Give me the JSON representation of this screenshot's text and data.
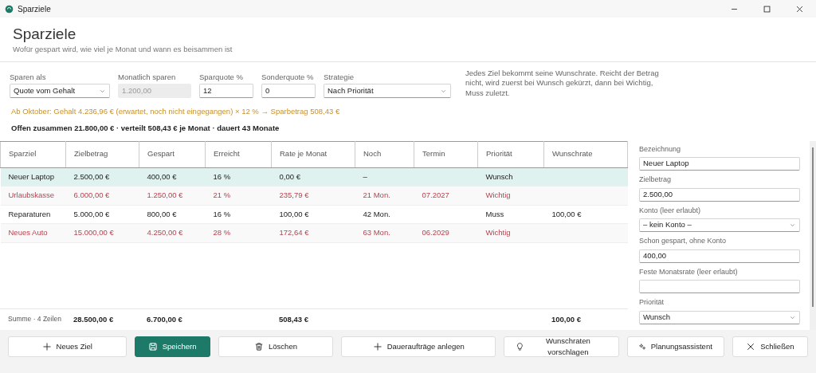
{
  "window": {
    "title": "Sparziele"
  },
  "header": {
    "title": "Sparziele",
    "subtitle": "Wofür gespart wird, wie viel je Monat und wann es beisammen ist"
  },
  "settings": [
    {
      "kind": "select",
      "label": "Sparen als",
      "value": "Quote vom Gehalt",
      "disabled": false
    },
    {
      "kind": "input",
      "label": "Monatlich sparen",
      "value": "1.200,00",
      "disabled": true
    },
    {
      "kind": "input",
      "label": "Sparquote %",
      "value": "12",
      "disabled": false
    },
    {
      "kind": "input",
      "label": "Sonderquote %",
      "value": "0",
      "disabled": false
    },
    {
      "kind": "select",
      "label": "Strategie",
      "value": "Nach Priorität",
      "disabled": false
    }
  ],
  "strategy_note": "Jedes Ziel bekommt seine Wunschrate. Reicht der Betrag nicht, wird zuerst bei Wunsch gekürzt, dann bei Wichtig, Muss zuletzt.",
  "forecast_note": "Ab Oktober: Gehalt 4.236,96 € (erwartet, noch nicht eingegangen) × 12 % → Sparbetrag 508,43 €",
  "summary": "Offen zusammen 21.800,00 € · verteilt 508,43 € je Monat · dauert 43 Monate",
  "table": {
    "columns": [
      "Sparziel",
      "Zielbetrag",
      "Gespart",
      "Erreicht",
      "Rate je Monat",
      "Noch",
      "Termin",
      "Priorität",
      "Wunschrate"
    ],
    "rows": [
      {
        "selected": true,
        "critical": false,
        "cells": [
          "Neuer Laptop",
          "2.500,00 €",
          "400,00 €",
          "16 %",
          "0,00 €",
          "–",
          "",
          "Wunsch",
          ""
        ]
      },
      {
        "selected": false,
        "critical": true,
        "cells": [
          "Urlaubskasse",
          "6.000,00 €",
          "1.250,00 €",
          "21 %",
          "235,79 €",
          "21 Mon.",
          "07.2027",
          "Wichtig",
          ""
        ]
      },
      {
        "selected": false,
        "critical": false,
        "cells": [
          "Reparaturen",
          "5.000,00 €",
          "800,00 €",
          "16 %",
          "100,00 €",
          "42 Mon.",
          "",
          "Muss",
          "100,00 €"
        ]
      },
      {
        "selected": false,
        "critical": true,
        "cells": [
          "Neues Auto",
          "15.000,00 €",
          "4.250,00 €",
          "28 %",
          "172,64 €",
          "63 Mon.",
          "06.2029",
          "Wichtig",
          ""
        ]
      }
    ],
    "totals": {
      "label": "Summe · 4 Zeilen",
      "zielbetrag": "28.500,00 €",
      "gespart": "6.700,00 €",
      "rate_je_monat": "508,43 €",
      "wunschrate": "100,00 €"
    }
  },
  "details": [
    {
      "kind": "input",
      "label": "Bezeichnung",
      "value": "Neuer Laptop"
    },
    {
      "kind": "input",
      "label": "Zielbetrag",
      "value": "2.500,00"
    },
    {
      "kind": "select",
      "label": "Konto (leer erlaubt)",
      "value": "– kein Konto –"
    },
    {
      "kind": "input",
      "label": "Schon gespart, ohne Konto",
      "value": "400,00"
    },
    {
      "kind": "input",
      "label": "Feste Monatsrate (leer erlaubt)"
    },
    {
      "kind": "select",
      "label": "Priorität",
      "value": "Wunsch"
    }
  ],
  "buttons": [
    {
      "label": "Neues Ziel",
      "primary": false
    },
    {
      "label": "Speichern",
      "primary": true
    },
    {
      "label": "Löschen",
      "primary": false
    },
    {
      "label": "Daueraufträge anlegen",
      "primary": false
    },
    {
      "label": "Wunschraten vorschlagen",
      "primary": false
    },
    {
      "label": "Planungsassistent",
      "primary": false
    },
    {
      "label": "Schließen",
      "primary": false
    }
  ]
}
